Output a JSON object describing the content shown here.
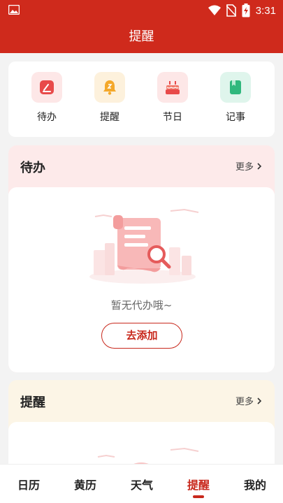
{
  "status": {
    "time": "3:31"
  },
  "header": {
    "title": "提醒"
  },
  "quick_actions": [
    {
      "label": "待办",
      "icon": "todo-icon"
    },
    {
      "label": "提醒",
      "icon": "bell-icon"
    },
    {
      "label": "节日",
      "icon": "cake-icon"
    },
    {
      "label": "记事",
      "icon": "notebook-icon"
    }
  ],
  "todo_section": {
    "title": "待办",
    "more_label": "更多",
    "empty_text": "暂无代办哦~",
    "add_label": "去添加"
  },
  "reminder_section": {
    "title": "提醒",
    "more_label": "更多"
  },
  "tabs": [
    {
      "label": "日历"
    },
    {
      "label": "黄历"
    },
    {
      "label": "天气"
    },
    {
      "label": "提醒"
    },
    {
      "label": "我的"
    }
  ],
  "active_tab": "提醒",
  "colors": {
    "brand": "#cf2a1c",
    "accent": "#c8281c",
    "todo_bg": "#fdeaea",
    "reminder_bg": "#fcf5e6"
  }
}
